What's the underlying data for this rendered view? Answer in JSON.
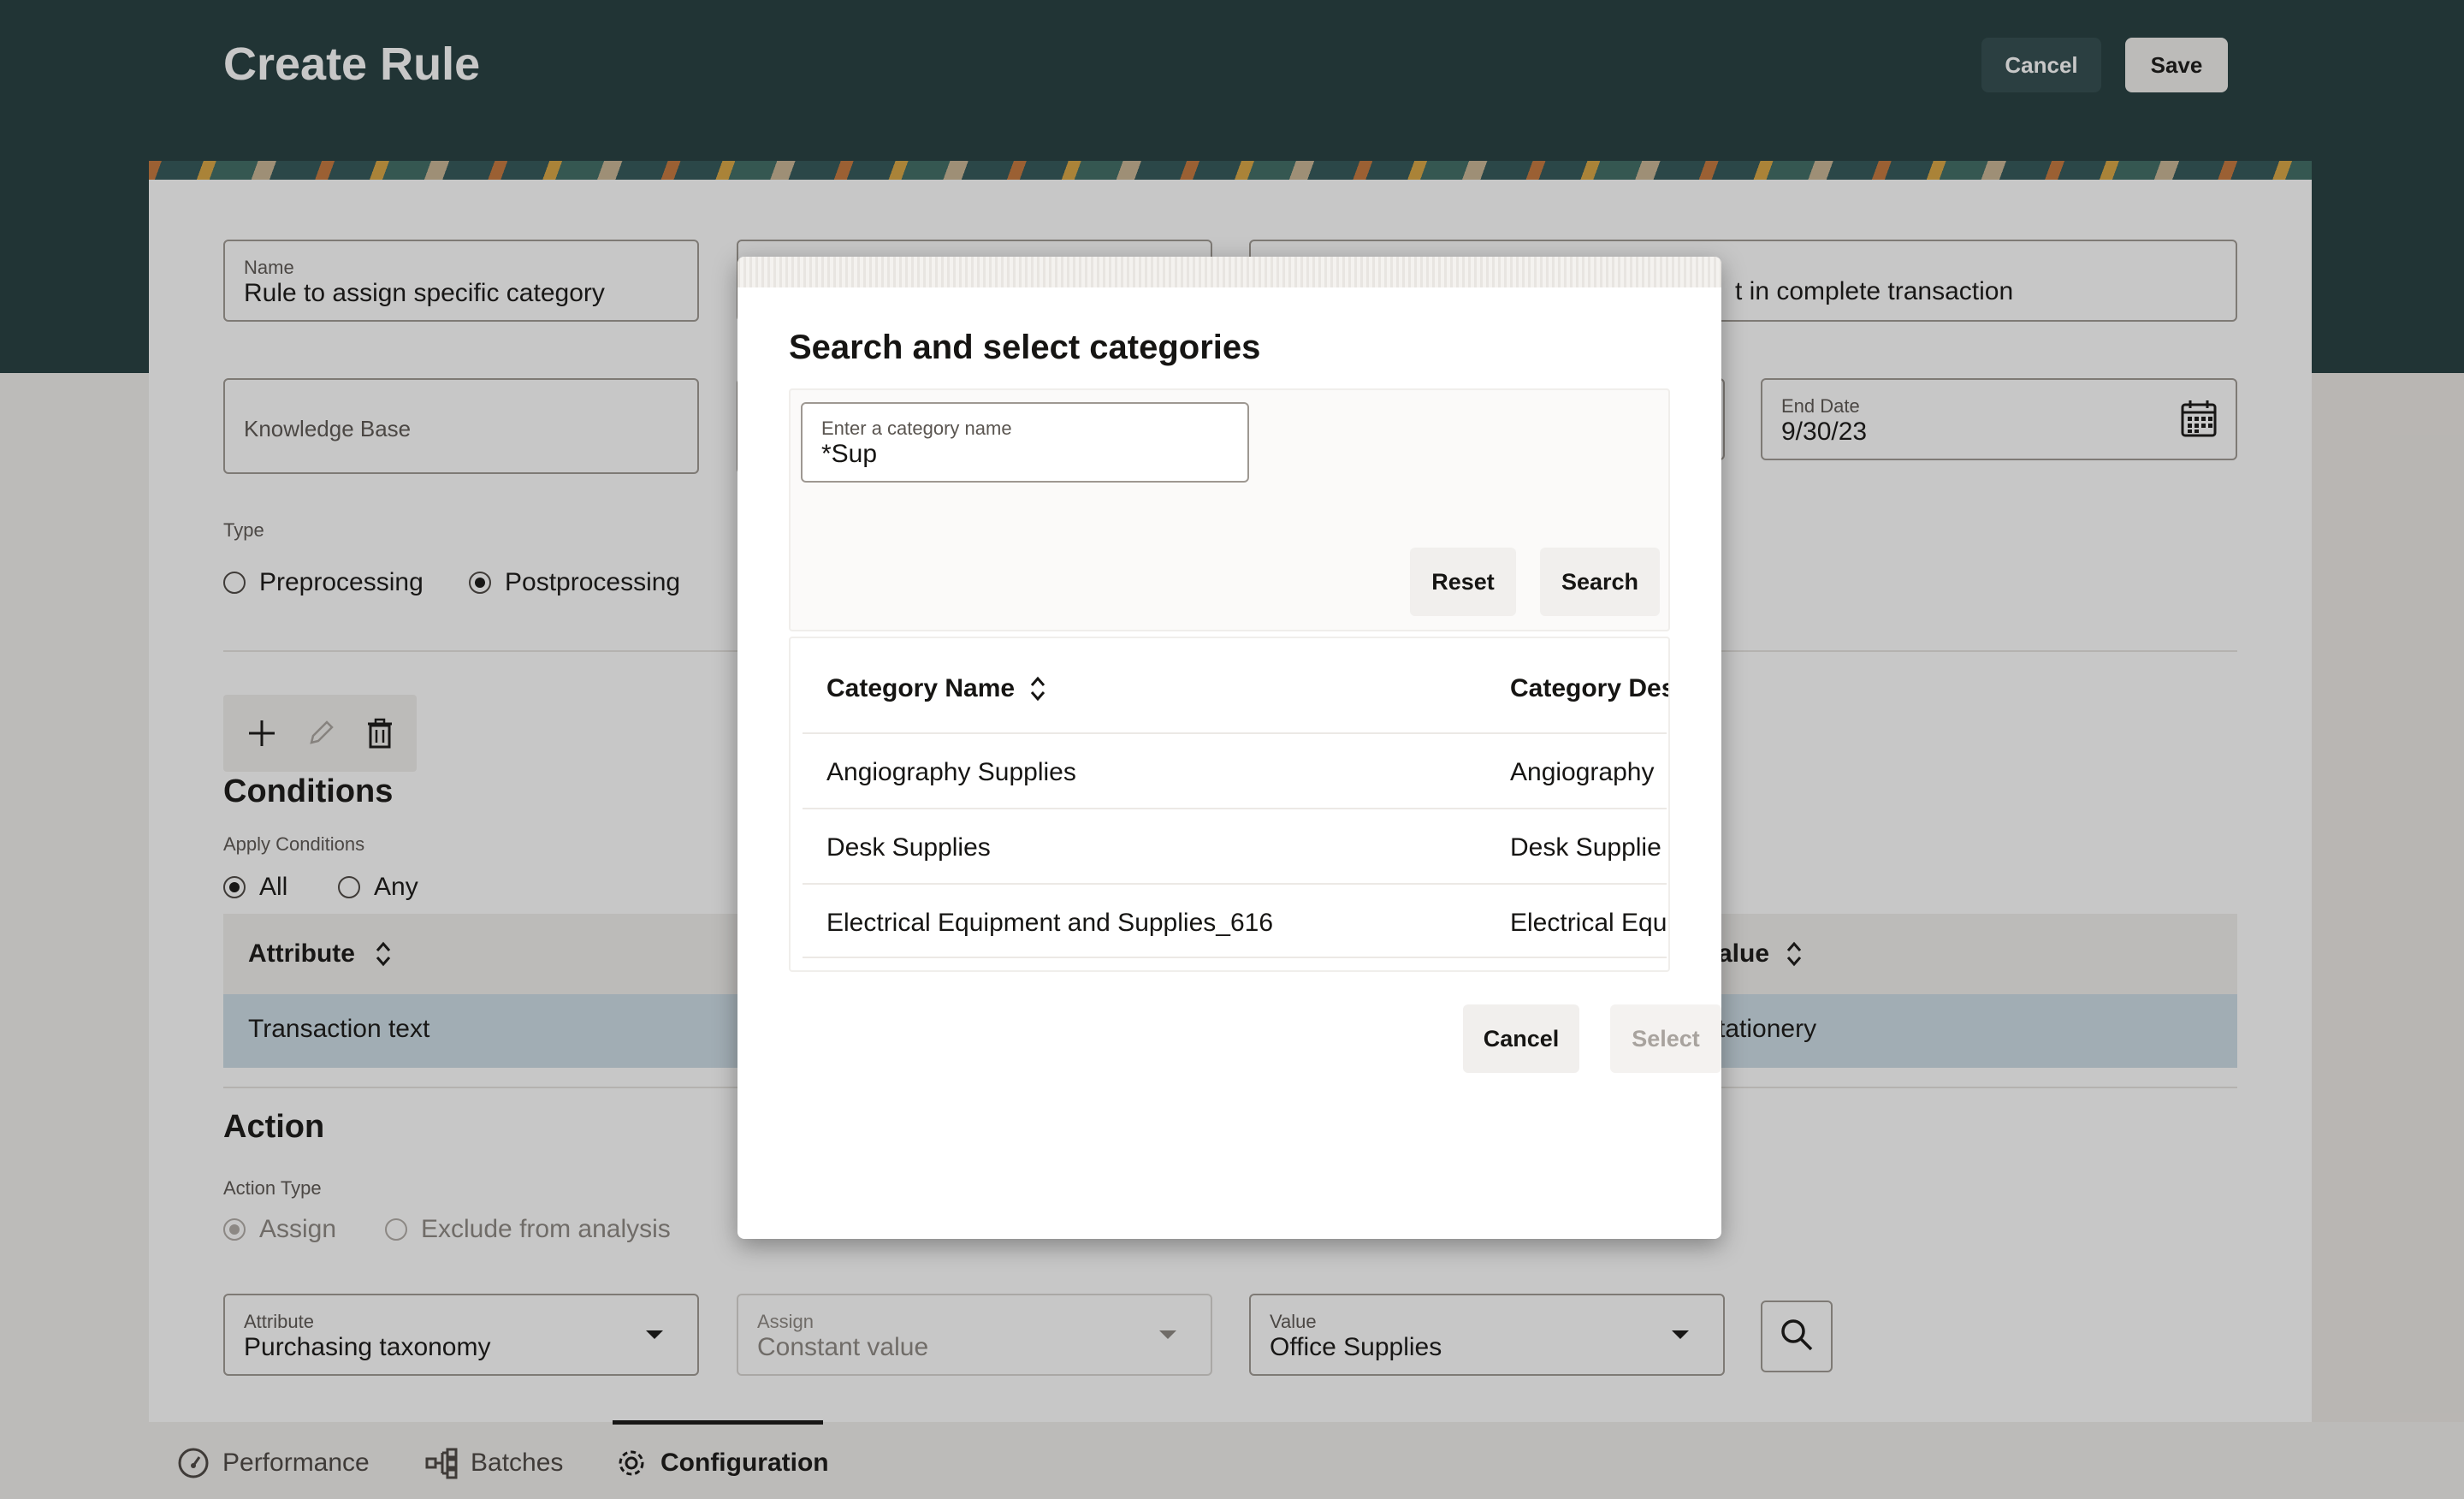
{
  "header": {
    "title": "Create Rule",
    "cancel_label": "Cancel",
    "save_label": "Save"
  },
  "form": {
    "name": {
      "label": "Name",
      "value": "Rule to assign specific category"
    },
    "description_value": "t in complete transaction",
    "knowledge_base": {
      "placeholder": "Knowledge Base"
    },
    "end_date": {
      "label": "End Date",
      "value": "9/30/23"
    },
    "type": {
      "label": "Type",
      "options": [
        {
          "label": "Preprocessing",
          "selected": false
        },
        {
          "label": "Postprocessing",
          "selected": true
        }
      ]
    }
  },
  "conditions": {
    "title": "Conditions",
    "apply_label": "Apply Conditions",
    "apply_options": [
      {
        "label": "All",
        "selected": true
      },
      {
        "label": "Any",
        "selected": false
      }
    ],
    "columns": {
      "attribute": "Attribute",
      "value": "alue"
    },
    "rows": [
      {
        "attribute": "Transaction text",
        "value": "tationery"
      }
    ]
  },
  "action": {
    "title": "Action",
    "type_label": "Action Type",
    "type_options": [
      {
        "label": "Assign",
        "selected": true
      },
      {
        "label": "Exclude from analysis",
        "selected": false
      }
    ],
    "attribute": {
      "label": "Attribute",
      "value": "Purchasing taxonomy"
    },
    "assign": {
      "label": "Assign",
      "value": "Constant value"
    },
    "value": {
      "label": "Value",
      "value": "Office Supplies"
    }
  },
  "bottom_nav": {
    "items": [
      {
        "label": "Performance",
        "icon": "gauge-icon",
        "active": false
      },
      {
        "label": "Batches",
        "icon": "hierarchy-icon",
        "active": false
      },
      {
        "label": "Configuration",
        "icon": "gear-icon",
        "active": true
      }
    ]
  },
  "dialog": {
    "title": "Search and select categories",
    "search": {
      "label": "Enter a category name",
      "value": "*Sup"
    },
    "reset_label": "Reset",
    "search_label": "Search",
    "columns": {
      "name": "Category Name",
      "description": "Category Des"
    },
    "rows": [
      {
        "name": "Angiography Supplies",
        "description": "Angiography"
      },
      {
        "name": "Desk Supplies",
        "description": "Desk Supplie"
      },
      {
        "name": "Electrical Equipment and Supplies_616",
        "description": "Electrical Equ"
      }
    ],
    "cancel_label": "Cancel",
    "select_label": "Select"
  },
  "colors": {
    "header_bg": "#223b3d",
    "selected_row": "#cddde6",
    "button_neutral": "#f1efed"
  }
}
